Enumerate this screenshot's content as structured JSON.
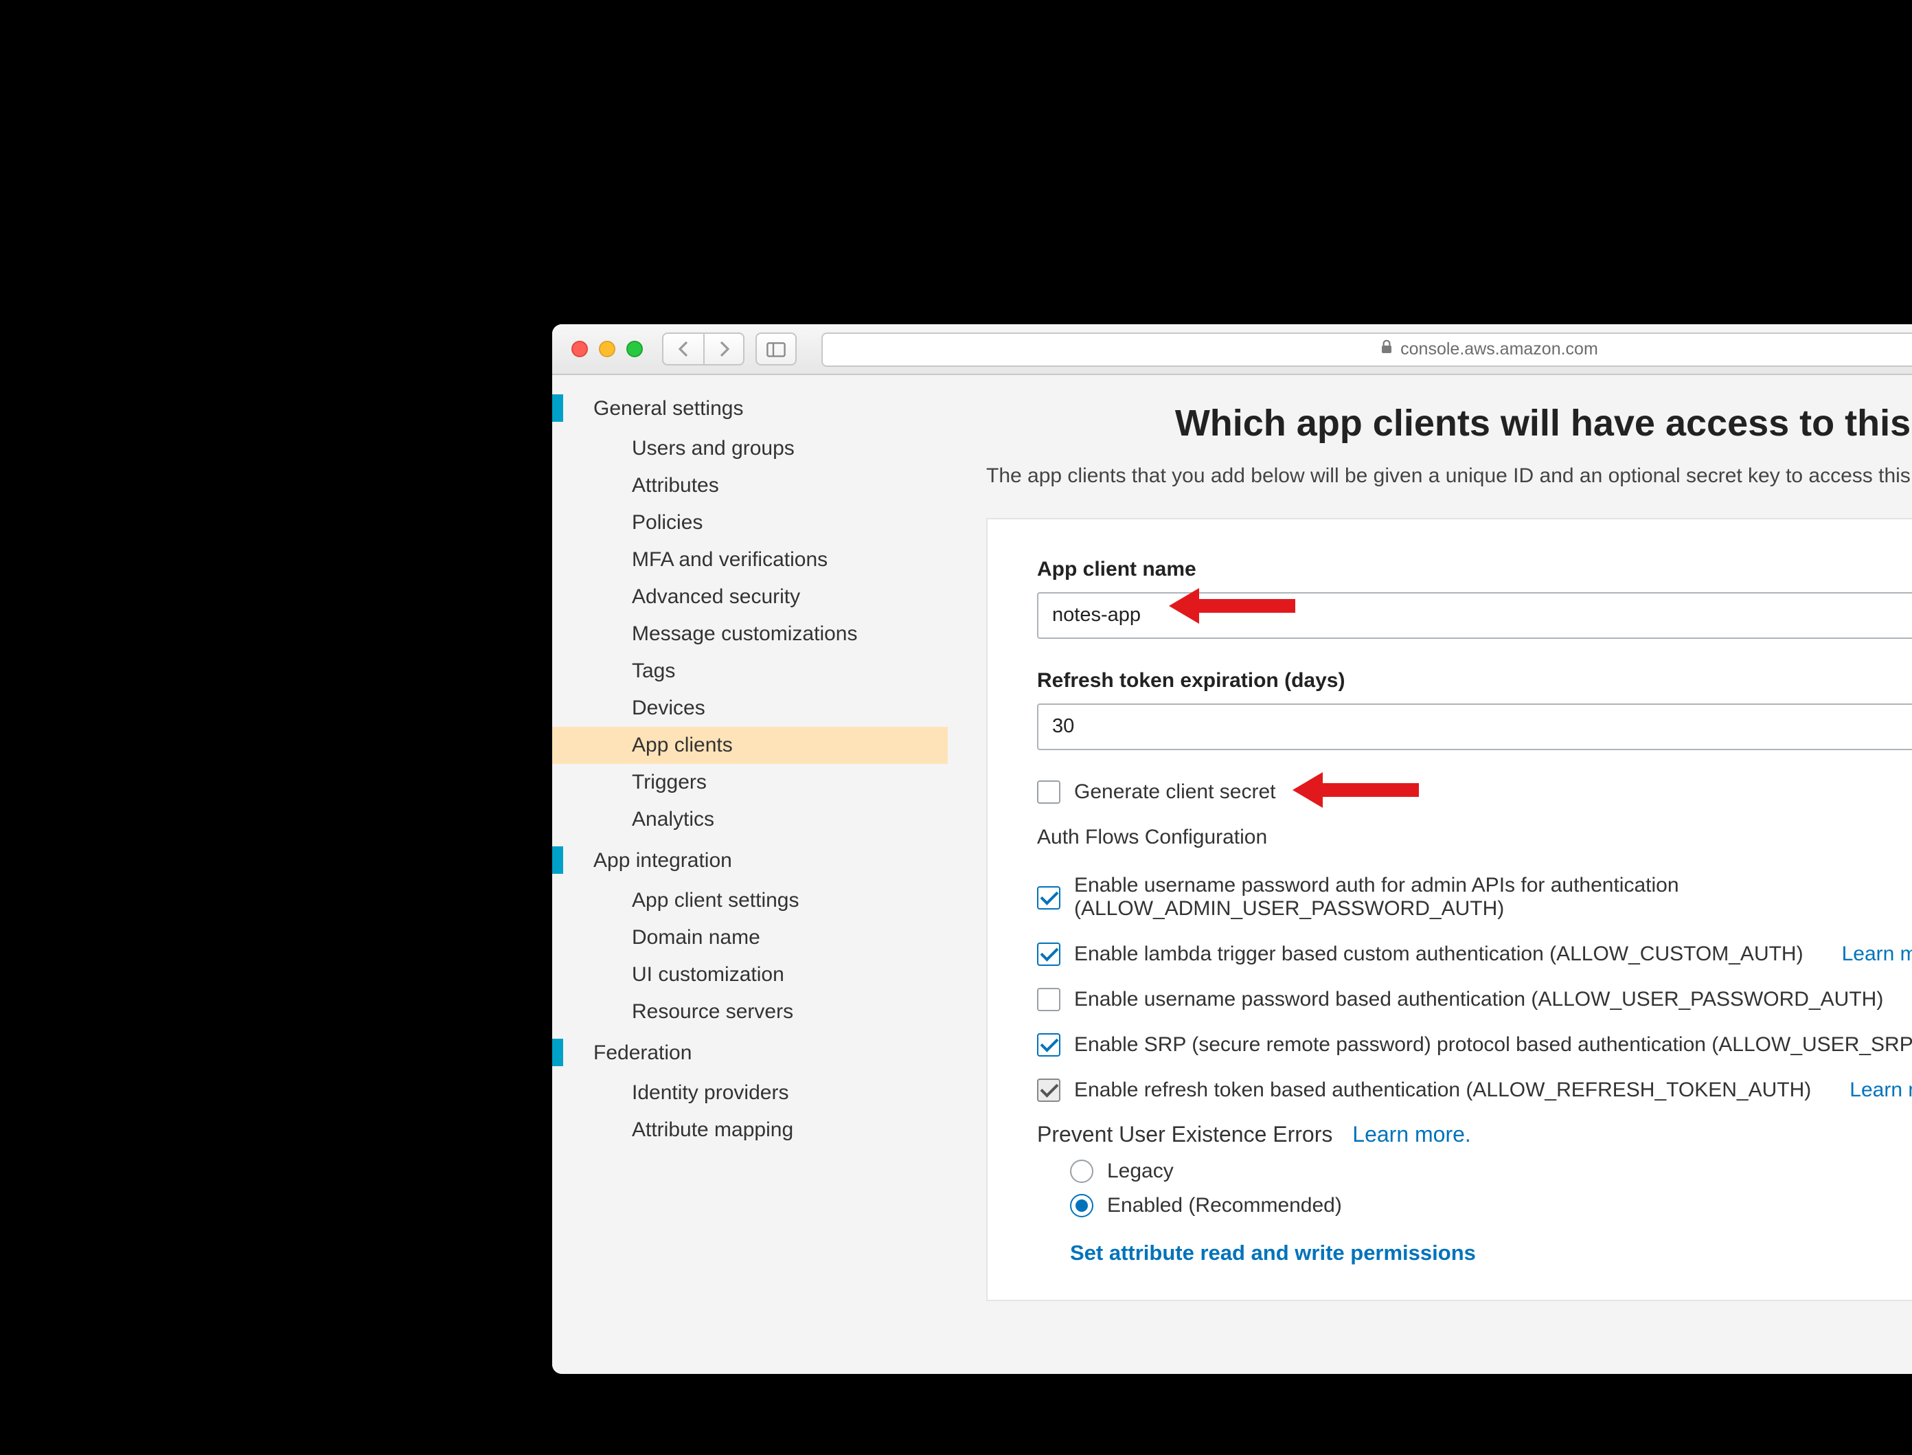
{
  "browser": {
    "url_host": "console.aws.amazon.com"
  },
  "sidebar": {
    "sections": [
      {
        "label": "General settings",
        "items": [
          "Users and groups",
          "Attributes",
          "Policies",
          "MFA and verifications",
          "Advanced security",
          "Message customizations",
          "Tags",
          "Devices",
          "App clients",
          "Triggers",
          "Analytics"
        ]
      },
      {
        "label": "App integration",
        "items": [
          "App client settings",
          "Domain name",
          "UI customization",
          "Resource servers"
        ]
      },
      {
        "label": "Federation",
        "items": [
          "Identity providers",
          "Attribute mapping"
        ]
      }
    ],
    "selected": "App clients"
  },
  "main": {
    "title": "Which app clients will have access to this user pool?",
    "subtitle": "The app clients that you add below will be given a unique ID and an optional secret key to access this user pool.",
    "app_client_name_label": "App client name",
    "app_client_name_value": "notes-app",
    "refresh_label": "Refresh token expiration (days)",
    "refresh_value": "30",
    "generate_secret_label": "Generate client secret",
    "auth_flows_heading": "Auth Flows Configuration",
    "learn_more": "Learn more.",
    "flows": [
      {
        "checked": true,
        "grey": false,
        "label": "Enable username password auth for admin APIs for authentication (ALLOW_ADMIN_USER_PASSWORD_AUTH)"
      },
      {
        "checked": true,
        "grey": false,
        "label": "Enable lambda trigger based custom authentication (ALLOW_CUSTOM_AUTH)"
      },
      {
        "checked": false,
        "grey": false,
        "label": "Enable username password based authentication (ALLOW_USER_PASSWORD_AUTH)"
      },
      {
        "checked": true,
        "grey": false,
        "label": "Enable SRP (secure remote password) protocol based authentication (ALLOW_USER_SRP_AUTH)"
      },
      {
        "checked": true,
        "grey": true,
        "label": "Enable refresh token based authentication (ALLOW_REFRESH_TOKEN_AUTH)"
      }
    ],
    "prevent_errors_label": "Prevent User Existence Errors",
    "radios": [
      {
        "selected": false,
        "label": "Legacy"
      },
      {
        "selected": true,
        "label": "Enabled (Recommended)"
      }
    ],
    "expander_label": "Set attribute read and write permissions"
  }
}
